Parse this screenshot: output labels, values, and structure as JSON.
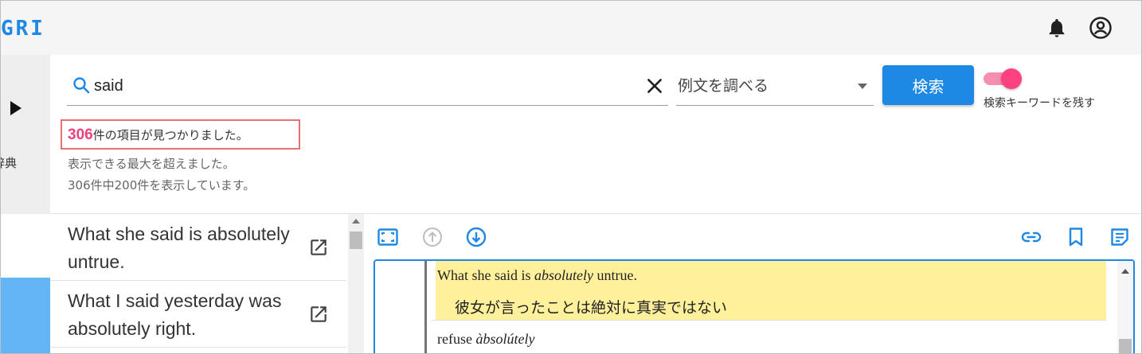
{
  "app": {
    "logo": "GRI"
  },
  "rail": {
    "label": "辞典"
  },
  "search": {
    "query": "said",
    "mode_selected": "例文を調べる",
    "submit_label": "検索",
    "keep_keyword_label": "検索キーワードを残す",
    "keep_keyword_on": true
  },
  "result": {
    "count": "306",
    "found_suffix": "件の項目が見つかりました。",
    "note_limit": "表示できる最大を超えました。",
    "note_shown": "306件中200件を表示しています。"
  },
  "list": {
    "items": [
      {
        "text": "What she said is absolutely untrue."
      },
      {
        "text": "What I said yesterday was absolutely right."
      }
    ]
  },
  "detail": {
    "example_en_before": "What she said is ",
    "example_en_em": "absolutely",
    "example_en_after": " untrue.",
    "example_ja": "彼女が言ったことは絶対に真実ではない",
    "next_plain": "refuse ",
    "next_em": "àbsolútely"
  },
  "colors": {
    "accent": "#1e88e5",
    "highlight": "#fff09c",
    "count": "#ec407a",
    "toggle": "#ff4081"
  },
  "icons": {
    "bell": "bell-icon",
    "account": "account-circle-icon",
    "search": "search-icon",
    "clear": "close-icon",
    "open": "open-in-new-icon",
    "fullscreen": "fullscreen-icon",
    "up": "arrow-up-circle-icon",
    "down": "arrow-down-circle-icon",
    "link": "link-icon",
    "bookmark": "bookmark-icon",
    "note": "note-icon"
  }
}
